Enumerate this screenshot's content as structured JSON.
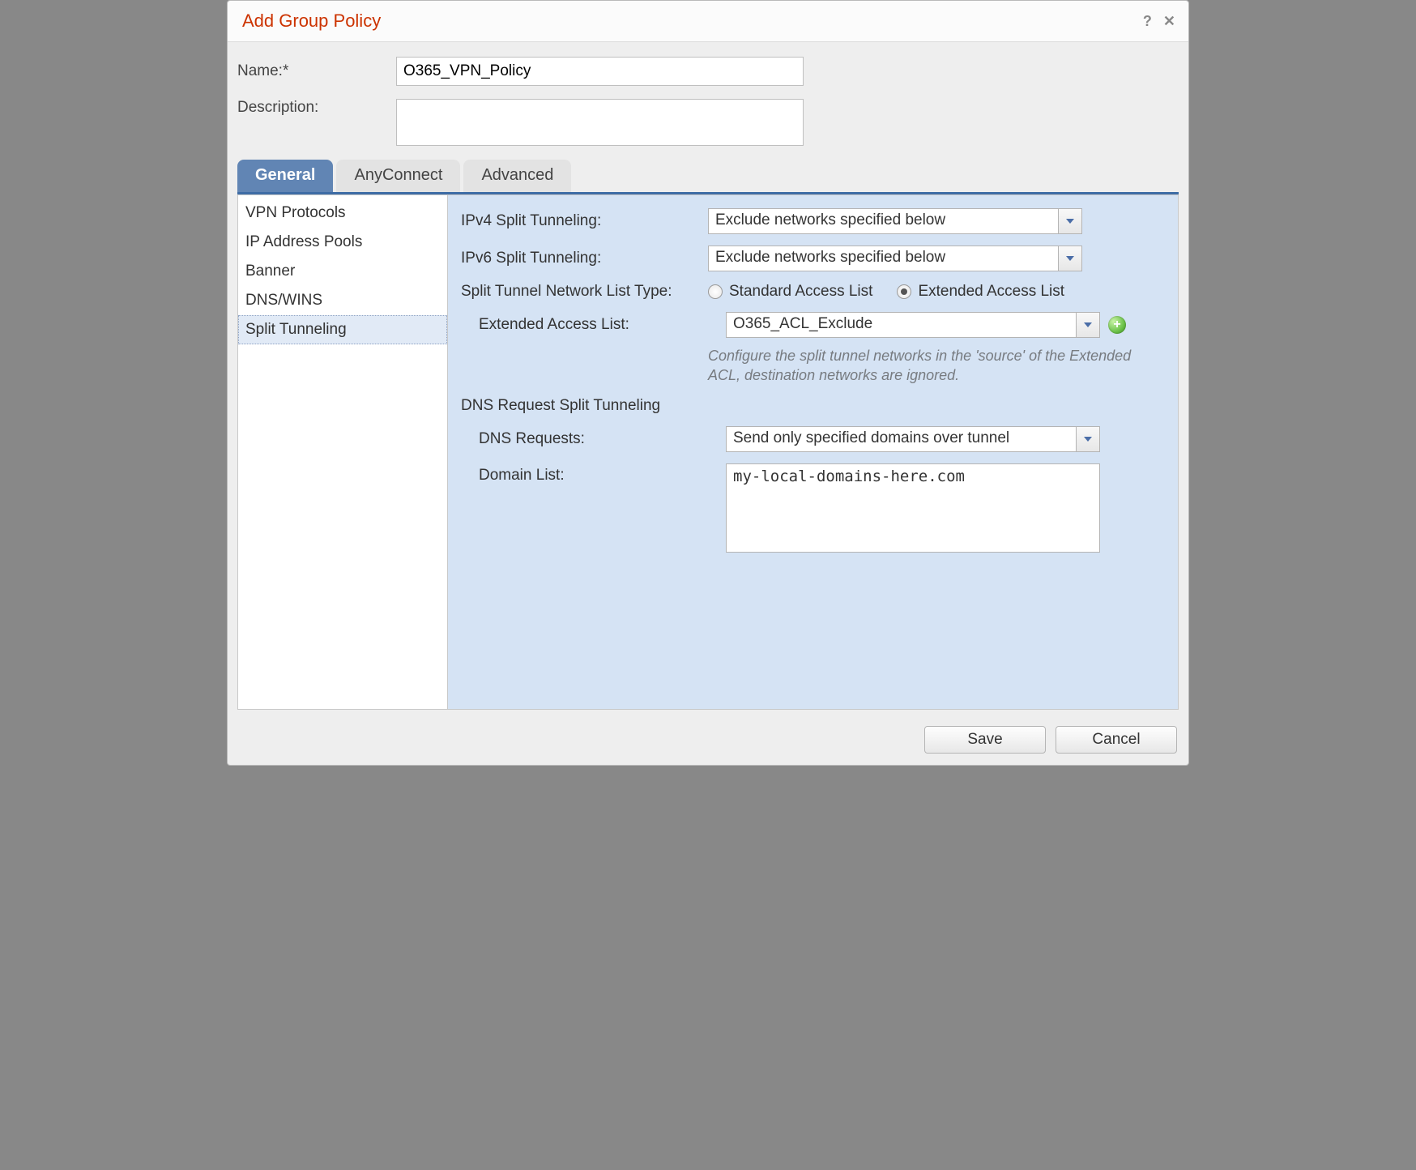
{
  "title": "Add Group Policy",
  "fields": {
    "name_label": "Name:*",
    "name_value": "O365_VPN_Policy",
    "description_label": "Description:",
    "description_value": ""
  },
  "tabs": [
    {
      "label": "General",
      "active": true
    },
    {
      "label": "AnyConnect",
      "active": false
    },
    {
      "label": "Advanced",
      "active": false
    }
  ],
  "sidebar": {
    "items": [
      {
        "label": "VPN Protocols",
        "selected": false
      },
      {
        "label": "IP Address Pools",
        "selected": false
      },
      {
        "label": "Banner",
        "selected": false
      },
      {
        "label": "DNS/WINS",
        "selected": false
      },
      {
        "label": "Split Tunneling",
        "selected": true
      }
    ]
  },
  "form": {
    "ipv4_label": "IPv4 Split Tunneling:",
    "ipv4_value": "Exclude networks specified below",
    "ipv6_label": "IPv6 Split Tunneling:",
    "ipv6_value": "Exclude networks specified below",
    "list_type_label": "Split Tunnel Network List Type:",
    "radio_standard": "Standard Access List",
    "radio_extended": "Extended Access List",
    "radio_selected": "extended",
    "ext_acl_label": "Extended Access List:",
    "ext_acl_value": "O365_ACL_Exclude",
    "hint": "Configure the split tunnel networks in the 'source' of the Extended ACL, destination networks are ignored.",
    "dns_section": "DNS Request Split Tunneling",
    "dns_req_label": "DNS Requests:",
    "dns_req_value": "Send only specified domains over tunnel",
    "domain_list_label": "Domain List:",
    "domain_list_value": "my-local-domains-here.com"
  },
  "buttons": {
    "save": "Save",
    "cancel": "Cancel"
  }
}
